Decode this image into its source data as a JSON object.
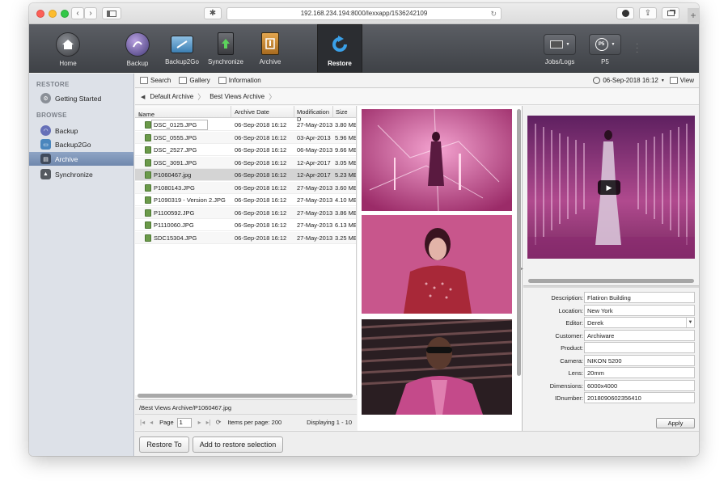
{
  "browser": {
    "url": "192.168.234.194:8000/lexxapp/1536242109",
    "back_icon": "chevron-left-icon",
    "forward_icon": "chevron-right-icon",
    "new_tab": "+"
  },
  "toolbar": {
    "items": [
      {
        "label": "Home",
        "icon": "home-icon"
      },
      {
        "label": "Backup",
        "icon": "backup-icon"
      },
      {
        "label": "Backup2Go",
        "icon": "backup2go-icon"
      },
      {
        "label": "Synchronize",
        "icon": "synchronize-icon"
      },
      {
        "label": "Archive",
        "icon": "archive-icon"
      },
      {
        "label": "Restore",
        "icon": "restore-icon",
        "active": true
      }
    ],
    "jobs_label": "Jobs/Logs",
    "p5_label": "P5",
    "p5_glyph": "P5"
  },
  "sidebar": {
    "restore_heading": "RESTORE",
    "restore_items": [
      {
        "label": "Getting Started"
      }
    ],
    "browse_heading": "BROWSE",
    "browse_items": [
      {
        "label": "Backup"
      },
      {
        "label": "Backup2Go"
      },
      {
        "label": "Archive",
        "selected": true
      },
      {
        "label": "Synchronize"
      }
    ]
  },
  "subbar": {
    "search": "Search",
    "gallery": "Gallery",
    "information": "Information",
    "date": "06-Sep-2018 16:12",
    "view": "View"
  },
  "breadcrumb": {
    "items": [
      "Default Archive",
      "Best Views Archive"
    ]
  },
  "filelist": {
    "columns": [
      "Name",
      "Archive Date",
      "Modification D",
      "Size"
    ],
    "sort_indicator": "▴",
    "rows": [
      {
        "name": "DSC_0125.JPG",
        "archive_date": "06-Sep-2018 16:12",
        "mod_date": "27-May-2013",
        "size": "3.80 MB"
      },
      {
        "name": "DSC_0555.JPG",
        "archive_date": "06-Sep-2018 16:12",
        "mod_date": "03-Apr-2013",
        "size": "5.96 MB"
      },
      {
        "name": "DSC_2527.JPG",
        "archive_date": "06-Sep-2018 16:12",
        "mod_date": "06-May-2013",
        "size": "9.66 MB"
      },
      {
        "name": "DSC_3091.JPG",
        "archive_date": "06-Sep-2018 16:12",
        "mod_date": "12-Apr-2017",
        "size": "3.05 MB"
      },
      {
        "name": "P1060467.jpg",
        "archive_date": "06-Sep-2018 16:12",
        "mod_date": "12-Apr-2017",
        "size": "5.23 MB",
        "selected": true
      },
      {
        "name": "P1080143.JPG",
        "archive_date": "06-Sep-2018 16:12",
        "mod_date": "27-May-2013",
        "size": "3.60 MB"
      },
      {
        "name": "P1090319 - Version 2.JPG",
        "archive_date": "06-Sep-2018 16:12",
        "mod_date": "27-May-2013",
        "size": "4.10 MB"
      },
      {
        "name": "P1100592.JPG",
        "archive_date": "06-Sep-2018 16:12",
        "mod_date": "27-May-2013",
        "size": "3.86 MB"
      },
      {
        "name": "P1110060.JPG",
        "archive_date": "06-Sep-2018 16:12",
        "mod_date": "27-May-2013",
        "size": "6.13 MB"
      },
      {
        "name": "SDC15304.JPG",
        "archive_date": "06-Sep-2018 16:12",
        "mod_date": "27-May-2013",
        "size": "3.25 MB"
      }
    ],
    "path": "/Best Views Archive/P1060467.jpg"
  },
  "pager": {
    "page_label": "Page",
    "page_value": "1",
    "items_per_page": "Items per page: 200",
    "displaying": "Displaying 1 - 10"
  },
  "actions": {
    "restore_to": "Restore To",
    "add_to_restore": "Add to restore selection"
  },
  "details": {
    "fields": [
      {
        "label": "Description:",
        "value": "Flatiron Building"
      },
      {
        "label": "Location:",
        "value": "New York"
      },
      {
        "label": "Editor:",
        "value": "Derek",
        "dropdown": true
      },
      {
        "label": "Customer:",
        "value": "Archiware"
      },
      {
        "label": "Product:",
        "value": ""
      },
      {
        "label": "Camera:",
        "value": "NIKON 5200"
      },
      {
        "label": "Lens:",
        "value": "20mm"
      },
      {
        "label": "Dimensions:",
        "value": "6000x4000"
      },
      {
        "label": "IDnumber:",
        "value": "2018090602356410"
      }
    ],
    "apply": "Apply"
  },
  "colors": {
    "toolbar_bg": "#4b4e53",
    "sidebar_bg": "#dde1e8",
    "selected": "#7a90b4",
    "image_magenta": "#c0457e"
  }
}
